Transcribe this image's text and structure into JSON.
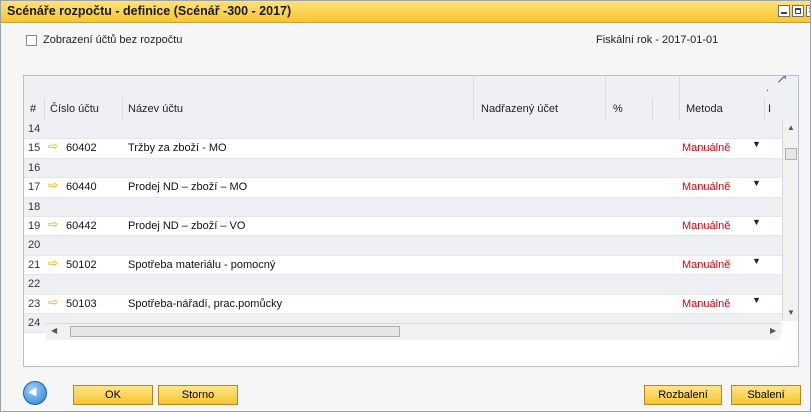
{
  "window": {
    "title": "Scénáře rozpočtu - definice (Scénář -300 - 2017)"
  },
  "options": {
    "show_accounts_label": "Zobrazení účtů bez rozpočtu",
    "fiscal_year": "Fiskální rok - 2017-01-01"
  },
  "grid": {
    "columns": [
      "#",
      "Číslo účtu",
      "Název účtu",
      "Nadřazený účet",
      "%",
      "Metoda",
      "I"
    ],
    "rows": [
      {
        "num": "14",
        "account": "",
        "name": "",
        "method": ""
      },
      {
        "num": "15",
        "account": "60402",
        "name": "Tržby za zboží - MO",
        "method": "Manuálně"
      },
      {
        "num": "16",
        "account": "",
        "name": "",
        "method": ""
      },
      {
        "num": "17",
        "account": "60440",
        "name": "Prodej ND – zboží – MO",
        "method": "Manuálně"
      },
      {
        "num": "18",
        "account": "",
        "name": "",
        "method": ""
      },
      {
        "num": "19",
        "account": "60442",
        "name": "Prodej ND – zboží – VO",
        "method": "Manuálně"
      },
      {
        "num": "20",
        "account": "",
        "name": "",
        "method": ""
      },
      {
        "num": "21",
        "account": "50102",
        "name": "Spotřeba materiálu - pomocný",
        "method": "Manuálně"
      },
      {
        "num": "22",
        "account": "",
        "name": "",
        "method": ""
      },
      {
        "num": "23",
        "account": "50103",
        "name": "Spotřeba-nářadí, prac.pomůcky",
        "method": "Manuálně"
      },
      {
        "num": "24",
        "account": "",
        "name": "",
        "method": ""
      }
    ]
  },
  "buttons": {
    "ok": "OK",
    "storno": "Storno",
    "rozbaleni": "Rozbalení",
    "sbaleni": "Sbalení"
  },
  "colors": {
    "title_bar": "#f7c530",
    "method_text": "#d8000c",
    "arrow": "#f0a800"
  }
}
